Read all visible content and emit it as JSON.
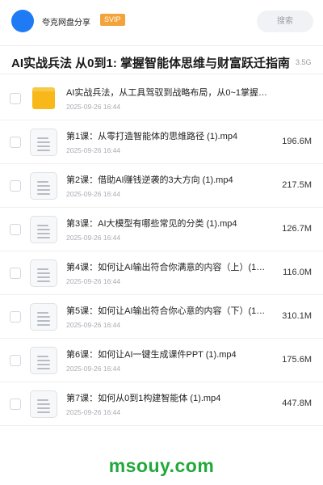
{
  "header": {
    "share_name": "夸克网盘分享",
    "badge": "SVIP",
    "search_label": "搜索"
  },
  "folder_title": "AI实战兵法 从0到1: 掌握智能体思维与财富跃迁指南",
  "folder_size": "3.5G",
  "items": [
    {
      "name": "AI实战兵法，从工具驾驭到战略布局，从0~1掌握…",
      "date": "2025-09-26 16:44",
      "size": "",
      "type": "folder"
    },
    {
      "name": "第1课：从零打造智能体的思维路径 (1).mp4",
      "date": "2025-09-26 16:44",
      "size": "196.6M",
      "type": "file"
    },
    {
      "name": "第2课：借助AI赚钱逆袭的3大方向 (1).mp4",
      "date": "2025-09-26 16:44",
      "size": "217.5M",
      "type": "file"
    },
    {
      "name": "第3课：AI大模型有哪些常见的分类 (1).mp4",
      "date": "2025-09-26 16:44",
      "size": "126.7M",
      "type": "file"
    },
    {
      "name": "第4课：如何让AI输出符合你满意的内容（上）(1…",
      "date": "2025-09-26 16:44",
      "size": "116.0M",
      "type": "file"
    },
    {
      "name": "第5课：如何让AI输出符合你心意的内容（下）(1…",
      "date": "2025-09-26 16:44",
      "size": "310.1M",
      "type": "file"
    },
    {
      "name": "第6课：如何让AI一键生成课件PPT (1).mp4",
      "date": "2025-09-26 16:44",
      "size": "175.6M",
      "type": "file"
    },
    {
      "name": "第7课：如何从0到1构建智能体 (1).mp4",
      "date": "2025-09-26 16:44",
      "size": "447.8M",
      "type": "file"
    }
  ],
  "watermark": "msouy.com",
  "colors": {
    "accent_blue": "#1e7bf5",
    "svip_orange": "#f3a33a",
    "folder_yellow": "#f8b819",
    "watermark_green": "#22a83a"
  }
}
